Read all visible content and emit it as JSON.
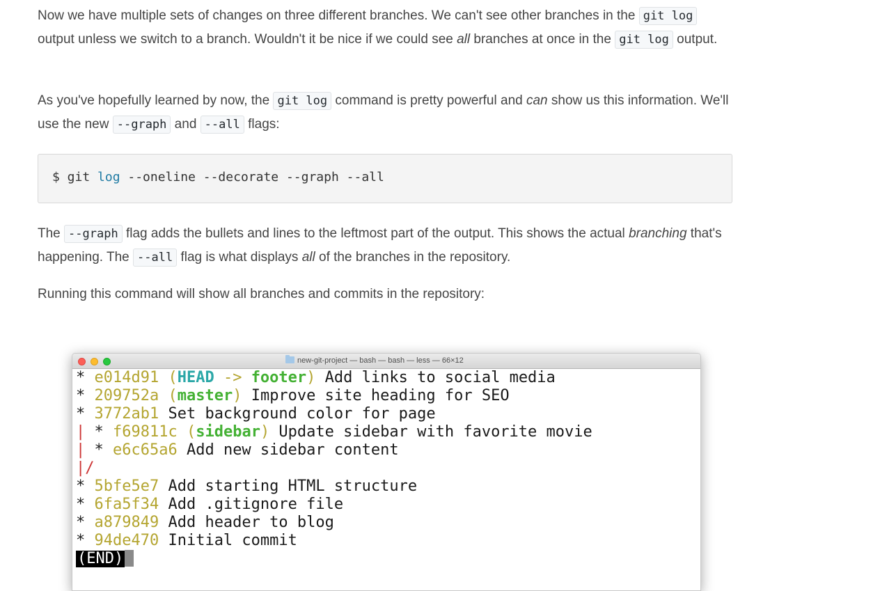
{
  "paragraphs": {
    "p1": {
      "t1": "Now we have multiple sets of changes on three different branches. We can't see other branches in the ",
      "c1": "git log",
      "t2": " output unless we switch to a branch. Wouldn't it be nice if we could see ",
      "em1": "all",
      "t3": " branches at once in the ",
      "c2": "git log",
      "t4": " output."
    },
    "p2": {
      "t1": "As you've hopefully learned by now, the ",
      "c1": "git log",
      "t2": " command is pretty powerful and ",
      "em1": "can",
      "t3": " show us this information. We'll use the new ",
      "c2": "--graph",
      "t4": " and ",
      "c3": "--all",
      "t5": " flags:"
    },
    "p3": {
      "t1": "The ",
      "c1": "--graph",
      "t2": " flag adds the bullets and lines to the leftmost part of the output. This shows the actual ",
      "em1": "branching",
      "t3": " that's happening. The ",
      "c2": "--all",
      "t4": " flag is what displays ",
      "em2": "all",
      "t5": " of the branches in the repository."
    },
    "p4": {
      "t1": "Running this command will show all branches and commits in the repository:"
    }
  },
  "command": {
    "prompt": "$ git ",
    "keyword": "log",
    "args": " --oneline --decorate --graph --all"
  },
  "terminal": {
    "title": "new-git-project — bash — bash — less — 66×12",
    "lines": [
      {
        "graph": "* ",
        "hash": "e014d91",
        "refs_open": " (",
        "head": "HEAD",
        "arrow": " -> ",
        "branch": "footer",
        "refs_close": ")",
        "msg": " Add links to social media"
      },
      {
        "graph": "* ",
        "hash": "209752a",
        "refs_open": " (",
        "branch": "master",
        "refs_close": ")",
        "msg": " Improve site heading for SEO"
      },
      {
        "graph": "* ",
        "hash": "3772ab1",
        "msg": " Set background color for page"
      },
      {
        "bar": "| ",
        "graph": "* ",
        "hash": "f69811c",
        "refs_open": " (",
        "branch": "sidebar",
        "refs_close": ")",
        "msg": " Update sidebar with favorite movie"
      },
      {
        "bar": "| ",
        "graph": "* ",
        "hash": "e6c65a6",
        "msg": " Add new sidebar content"
      },
      {
        "bar": "|/"
      },
      {
        "graph": "* ",
        "hash": "5bfe5e7",
        "msg": " Add starting HTML structure"
      },
      {
        "graph": "* ",
        "hash": "6fa5f34",
        "msg": " Add .gitignore file"
      },
      {
        "graph": "* ",
        "hash": "a879849",
        "msg": " Add header to blog"
      },
      {
        "graph": "* ",
        "hash": "94de470",
        "msg": " Initial commit"
      }
    ],
    "end_label": "(END)"
  },
  "colors": {
    "hash": "#b4a530",
    "head": "#2aa7a7",
    "branch": "#44b134",
    "graph_line": "#cc3333"
  }
}
